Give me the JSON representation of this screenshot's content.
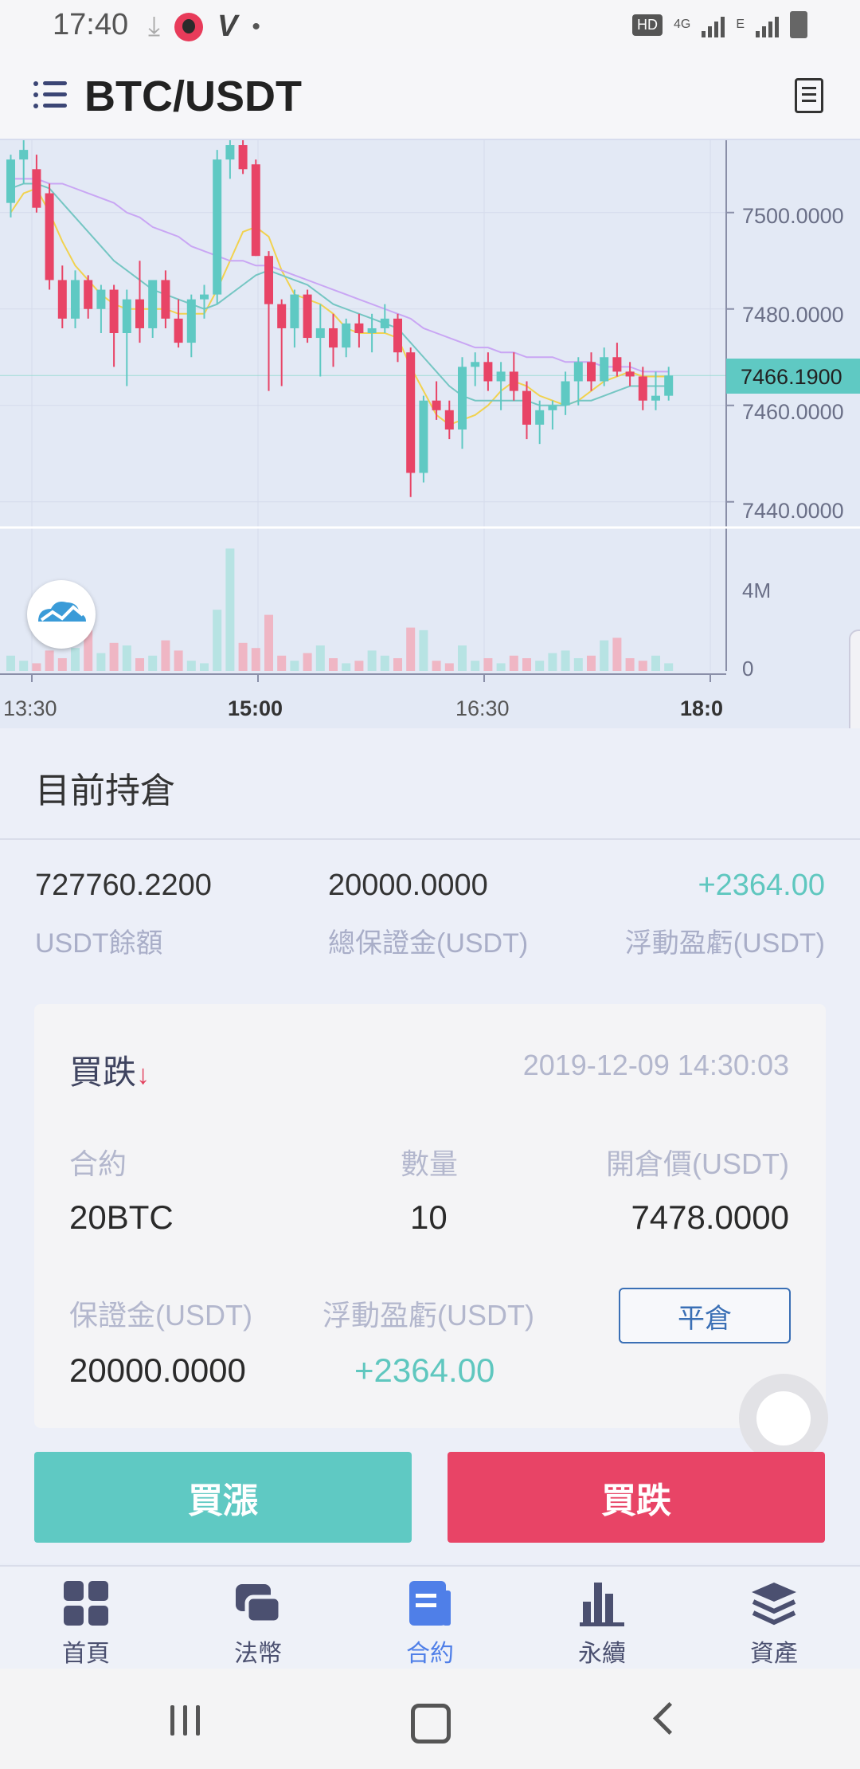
{
  "status_bar": {
    "time": "17:40",
    "hd": "HD",
    "net": "4G",
    "net2": "E"
  },
  "header": {
    "title": "BTC/USDT"
  },
  "chart": {
    "price_ticks": [
      "7500.0000",
      "7480.0000",
      "7460.0000",
      "7440.0000"
    ],
    "current_price": "7466.1900",
    "volume_ticks": [
      "4M",
      "0"
    ],
    "time_ticks": [
      "13:30",
      "15:00",
      "16:30",
      "18:0"
    ]
  },
  "positions": {
    "title": "目前持倉",
    "summary": [
      {
        "value": "727760.2200",
        "label": "USDT餘額"
      },
      {
        "value": "20000.0000",
        "label": "總保證金(USDT)"
      },
      {
        "value": "+2364.00",
        "label": "浮動盈虧(USDT)"
      }
    ],
    "card": {
      "side": "買跌",
      "arrow": "↓",
      "time": "2019-12-09 14:30:03",
      "contract_label": "合約",
      "contract_value": "20BTC",
      "qty_label": "數量",
      "qty_value": "10",
      "open_label": "開倉價(USDT)",
      "open_value": "7478.0000",
      "margin_label": "保證金(USDT)",
      "margin_value": "20000.0000",
      "pnl_label": "浮動盈虧(USDT)",
      "pnl_value": "+2364.00",
      "close_label": "平倉"
    }
  },
  "actions": {
    "buy_up": "買漲",
    "buy_down": "買跌"
  },
  "nav": [
    {
      "label": "首頁",
      "icon": "home-grid-icon"
    },
    {
      "label": "法幣",
      "icon": "exchange-icon"
    },
    {
      "label": "合約",
      "icon": "contract-icon",
      "active": true
    },
    {
      "label": "永續",
      "icon": "bar-chart-icon"
    },
    {
      "label": "資產",
      "icon": "layers-icon"
    }
  ],
  "colors": {
    "up": "#5fc9c3",
    "down": "#e84466",
    "accent": "#4f7fe8"
  },
  "chart_data": {
    "type": "candlestick",
    "x_tick_labels": [
      "13:30",
      "15:00",
      "16:30",
      "18:0"
    ],
    "y_tick_labels": [
      "7500.0000",
      "7480.0000",
      "7460.0000",
      "7440.0000"
    ],
    "ylim": [
      7435,
      7515
    ],
    "last_price": 7466.19,
    "candles": [
      [
        7502,
        7512,
        7499,
        7511
      ],
      [
        7511,
        7515,
        7506,
        7513
      ],
      [
        7509,
        7512,
        7500,
        7501
      ],
      [
        7504,
        7506,
        7484,
        7486
      ],
      [
        7486,
        7489,
        7476,
        7478
      ],
      [
        7478,
        7488,
        7476,
        7486
      ],
      [
        7486,
        7487,
        7478,
        7480
      ],
      [
        7480,
        7485,
        7475,
        7484
      ],
      [
        7484,
        7485,
        7468,
        7475
      ],
      [
        7475,
        7484,
        7464,
        7482
      ],
      [
        7482,
        7490,
        7473,
        7476
      ],
      [
        7476,
        7486,
        7474,
        7486
      ],
      [
        7486,
        7488,
        7476,
        7478
      ],
      [
        7478,
        7482,
        7472,
        7473
      ],
      [
        7473,
        7483,
        7470,
        7482
      ],
      [
        7482,
        7485,
        7478,
        7483
      ],
      [
        7483,
        7513,
        7481,
        7511
      ],
      [
        7511,
        7515,
        7507,
        7514
      ],
      [
        7514,
        7516,
        7508,
        7509
      ],
      [
        7510,
        7511,
        7491,
        7491
      ],
      [
        7491,
        7492,
        7463,
        7481
      ],
      [
        7481,
        7482,
        7464,
        7476
      ],
      [
        7476,
        7484,
        7472,
        7483
      ],
      [
        7483,
        7484,
        7473,
        7474
      ],
      [
        7474,
        7481,
        7466,
        7476
      ],
      [
        7476,
        7479,
        7468,
        7472
      ],
      [
        7472,
        7478,
        7470,
        7477
      ],
      [
        7477,
        7479,
        7472,
        7475
      ],
      [
        7475,
        7479,
        7471,
        7476
      ],
      [
        7476,
        7481,
        7475,
        7478
      ],
      [
        7478,
        7479,
        7469,
        7471
      ],
      [
        7471,
        7472,
        7441,
        7446
      ],
      [
        7446,
        7462,
        7444,
        7461
      ],
      [
        7461,
        7465,
        7457,
        7459
      ],
      [
        7459,
        7461,
        7453,
        7455
      ],
      [
        7455,
        7470,
        7451,
        7468
      ],
      [
        7468,
        7471,
        7464,
        7469
      ],
      [
        7469,
        7471,
        7463,
        7465
      ],
      [
        7465,
        7469,
        7459,
        7467
      ],
      [
        7467,
        7471,
        7461,
        7463
      ],
      [
        7463,
        7465,
        7453,
        7456
      ],
      [
        7456,
        7461,
        7452,
        7459
      ],
      [
        7459,
        7461,
        7455,
        7460
      ],
      [
        7460,
        7467,
        7458,
        7465
      ],
      [
        7465,
        7470,
        7460,
        7469
      ],
      [
        7469,
        7471,
        7463,
        7465
      ],
      [
        7465,
        7472,
        7464,
        7470
      ],
      [
        7470,
        7473,
        7466,
        7467
      ],
      [
        7467,
        7469,
        7464,
        7466
      ],
      [
        7466,
        7468,
        7459,
        7461
      ],
      [
        7461,
        7467,
        7459,
        7462
      ],
      [
        7462,
        7468,
        7461,
        7466.19
      ]
    ],
    "volume_ylim": [
      0,
      5000000
    ],
    "volume": [
      600000,
      400000,
      300000,
      800000,
      500000,
      900000,
      1600000,
      700000,
      1100000,
      1000000,
      500000,
      600000,
      1200000,
      800000,
      400000,
      300000,
      2400000,
      4800000,
      1100000,
      900000,
      2200000,
      600000,
      400000,
      700000,
      1000000,
      500000,
      300000,
      400000,
      800000,
      600000,
      500000,
      1700000,
      1600000,
      400000,
      300000,
      1000000,
      400000,
      500000,
      300000,
      600000,
      500000,
      400000,
      700000,
      800000,
      500000,
      600000,
      1200000,
      1300000,
      500000,
      400000,
      600000,
      300000
    ],
    "ma": [
      {
        "color": "#f1d24f",
        "values": [
          7500,
          7504,
          7505,
          7500,
          7494,
          7489,
          7486,
          7483,
          7481,
          7480,
          7480,
          7480,
          7480,
          7479,
          7479,
          7479,
          7484,
          7490,
          7496,
          7497,
          7495,
          7488,
          7483,
          7482,
          7481,
          7479,
          7476,
          7475,
          7475,
          7475,
          7474,
          7468,
          7463,
          7458,
          7456,
          7457,
          7458,
          7460,
          7463,
          7465,
          7464,
          7462,
          7461,
          7460,
          7461,
          7463,
          7465,
          7466,
          7467,
          7466,
          7466,
          7466
        ]
      },
      {
        "color": "#75c6c3",
        "values": [
          7505,
          7506,
          7506,
          7505,
          7502,
          7499,
          7496,
          7493,
          7490,
          7488,
          7486,
          7484,
          7483,
          7482,
          7481,
          7480,
          7481,
          7483,
          7485,
          7487,
          7488,
          7487,
          7486,
          7485,
          7483,
          7481,
          7480,
          7479,
          7478,
          7477,
          7476,
          7473,
          7470,
          7467,
          7464,
          7462,
          7461,
          7461,
          7461,
          7461,
          7461,
          7460,
          7460,
          7460,
          7461,
          7461,
          7462,
          7463,
          7464,
          7464,
          7464,
          7464
        ]
      },
      {
        "color": "#c9a6f4",
        "values": [
          7507,
          7507,
          7507,
          7506,
          7506,
          7505,
          7504,
          7503,
          7502,
          7500,
          7499,
          7497,
          7496,
          7495,
          7493,
          7492,
          7491,
          7490,
          7490,
          7489,
          7489,
          7488,
          7487,
          7486,
          7485,
          7484,
          7483,
          7482,
          7481,
          7480,
          7479,
          7478,
          7476,
          7475,
          7474,
          7473,
          7472,
          7472,
          7471,
          7471,
          7470,
          7470,
          7470,
          7469,
          7469,
          7469,
          7468,
          7468,
          7468,
          7467,
          7467,
          7467
        ]
      }
    ]
  }
}
